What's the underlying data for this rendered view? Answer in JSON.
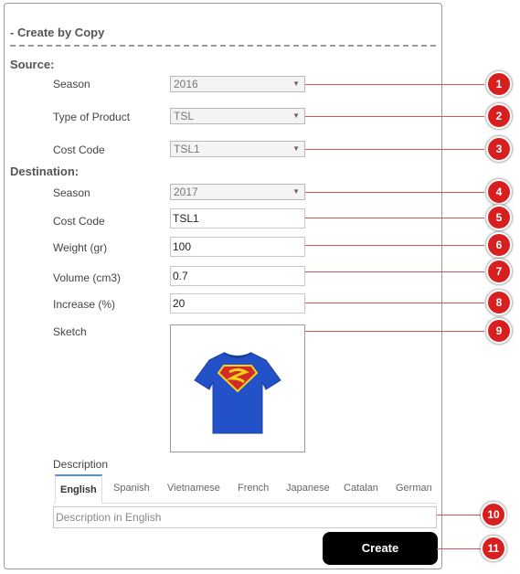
{
  "form": {
    "title": "- Create by Copy",
    "source_label": "Source:",
    "destination_label": "Destination:"
  },
  "source": {
    "season": {
      "label": "Season",
      "value": "2016"
    },
    "type_of_product": {
      "label": "Type of Product",
      "value": "TSL"
    },
    "cost_code": {
      "label": "Cost Code",
      "value": "TSL1"
    }
  },
  "destination": {
    "season": {
      "label": "Season",
      "value": "2017"
    },
    "cost_code": {
      "label": "Cost Code",
      "value": "TSL1"
    },
    "weight": {
      "label": "Weight (gr)",
      "value": "100"
    },
    "volume": {
      "label": "Volume (cm3)",
      "value": "0.7"
    },
    "increase": {
      "label": "Increase (%)",
      "value": "20"
    },
    "sketch": {
      "label": "Sketch"
    }
  },
  "description": {
    "label": "Description",
    "tabs": [
      "English",
      "Spanish",
      "Vietnamese",
      "French",
      "Japanese",
      "Catalan",
      "German"
    ],
    "active_tab": "English",
    "placeholder": "Description in English"
  },
  "actions": {
    "create_label": "Create"
  },
  "callouts": [
    "1",
    "2",
    "3",
    "4",
    "5",
    "6",
    "7",
    "8",
    "9",
    "10",
    "11"
  ],
  "colors": {
    "callout": "#d81f1f",
    "button": "#000000",
    "active_tab_accent": "#4a90e2"
  }
}
